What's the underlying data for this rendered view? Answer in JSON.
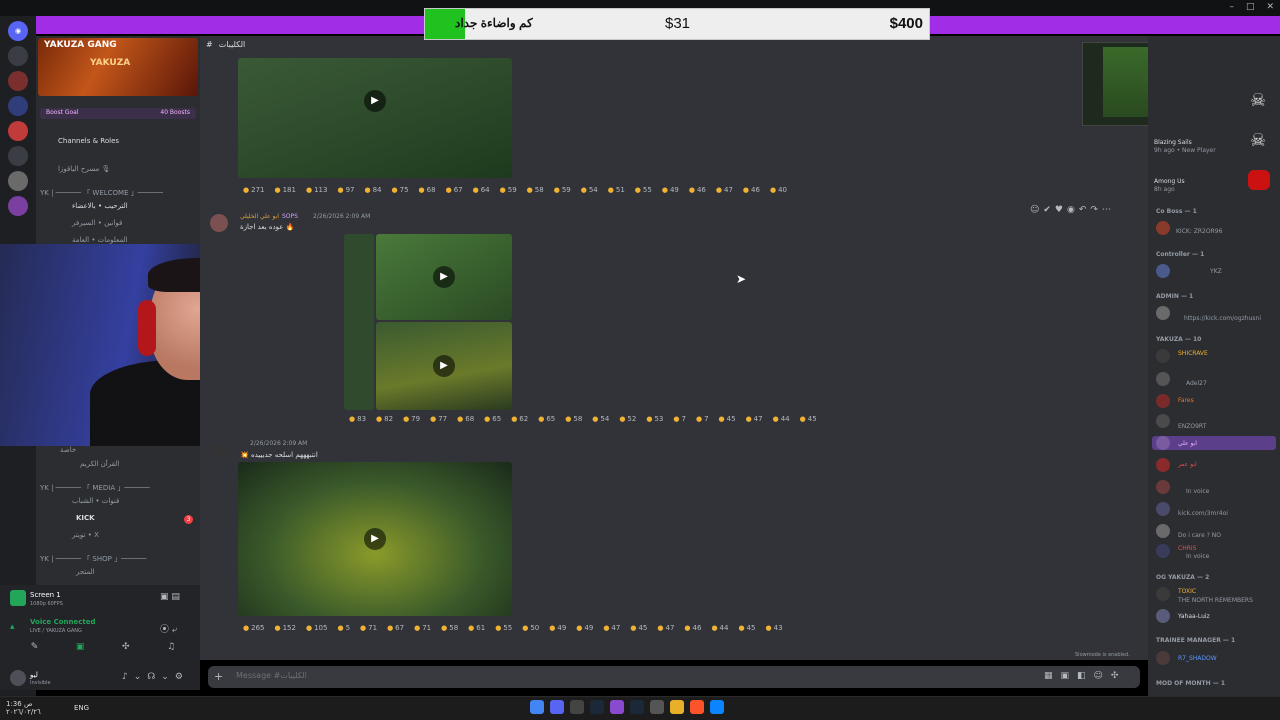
{
  "window": {
    "title": "YAKUZA GANG",
    "controls": [
      "–",
      "□",
      "✕"
    ]
  },
  "donation_goal": {
    "label": "كم واضاءة جداد",
    "current": "$31",
    "target": "$400",
    "progress": 0.0775
  },
  "server": {
    "name": "YAKUZA GANG",
    "banner_text": "YAKUZA",
    "boost_label": "Boost Goal",
    "boost_count": "40 Boosts",
    "channels": [
      {
        "label": "Channels & Roles"
      },
      {
        "label": "مسرح الياقوزا 🎙"
      },
      {
        "label": "YK | ────── 「 WELCOME 」──────"
      },
      {
        "label": "الترحيب • بالاعضاء"
      },
      {
        "label": "قوانين • السيرفر"
      },
      {
        "label": "المعلومات • العامة"
      },
      {
        "label": "خاصة"
      },
      {
        "label": "القرآن الكريم"
      },
      {
        "label": "YK | ────── 「 MEDIA 」──────"
      },
      {
        "label": "قنوات • الشباب"
      },
      {
        "label": "KICK"
      },
      {
        "label": "تويتر • X"
      },
      {
        "label": "YK | ────── 「 SHOP 」──────"
      },
      {
        "label": "المتجر"
      }
    ],
    "kick_badge": "3"
  },
  "voice": {
    "screen_label": "Screen 1",
    "screen_sub": "1080p 60FPS",
    "status": "Voice Connected",
    "channel": "LIVE / YAKUZA GANG",
    "user": "ليو",
    "user_status": "Invisible"
  },
  "chat": {
    "channel": "الكليبات",
    "input_placeholder": "Message #الكليبات",
    "slowmode": "Slowmode is enabled.",
    "messages": [
      {
        "reactions": [
          "271",
          "181",
          "113",
          "97",
          "84",
          "75",
          "68",
          "67",
          "64",
          "59",
          "58",
          "59",
          "54",
          "51",
          "55",
          "49",
          "46",
          "47",
          "46",
          "40"
        ]
      },
      {
        "author": "ابو علي الخليلي",
        "tag": "SOPS",
        "time": "2/26/2026 2:09 AM",
        "text": "عوده بعد اجازة 🔥",
        "reactions": [
          "83",
          "82",
          "79",
          "77",
          "68",
          "65",
          "62",
          "65",
          "58",
          "54",
          "52",
          "53",
          "7",
          "7",
          "45",
          "47",
          "44",
          "45"
        ]
      },
      {
        "author": "",
        "time": "2/26/2026 2:09 AM",
        "text": "💥 انتبهههم اسلحه جديييده",
        "reactions": [
          "265",
          "152",
          "105",
          "5",
          "71",
          "67",
          "71",
          "58",
          "61",
          "55",
          "50",
          "49",
          "49",
          "47",
          "45",
          "47",
          "46",
          "44",
          "45",
          "43"
        ]
      }
    ]
  },
  "members": {
    "activities": [
      {
        "name": "Blazing Sails",
        "sub": "9h ago • New Player"
      },
      {
        "name": "Among Us",
        "sub": "8h ago"
      }
    ],
    "groups": [
      {
        "title": "Co Boss — 1",
        "members": [
          "KICK: ZR2OR96"
        ]
      },
      {
        "title": "Controller — 1",
        "members": [
          "YKZ"
        ]
      },
      {
        "title": "ADMIN — 1",
        "members": [
          "https://kick.com/ogzhusni"
        ]
      },
      {
        "title": "YAKUZA — 10",
        "members": [
          "SHICRAVE",
          "Adel27",
          "Fares",
          "ENZO9RT",
          "ابو علي",
          "ابو عمر",
          "In voice",
          "kick.com/3mr4oi",
          "Do i care ? NO",
          "CHRIS",
          "In voice"
        ]
      },
      {
        "title": "OG YAKUZA — 2",
        "members": [
          "TOXIC",
          "THE NORTH REMEMBERS",
          "Yahaa-Luiz"
        ]
      },
      {
        "title": "TRAINEE MANAGER — 1",
        "members": [
          "R7_SHADOW"
        ]
      },
      {
        "title": "MOD OF MONTH — 1",
        "members": []
      }
    ]
  },
  "taskbar": {
    "time": "1:36 ص",
    "date": "٢٠٢٦/٠٢/٢٦",
    "lang": "ENG",
    "apps": [
      "chrome",
      "discord",
      "obs",
      "steam-icon",
      "app",
      "steam",
      "calc",
      "files",
      "brave",
      "windows"
    ]
  },
  "colors": {
    "accent": "#a12ee6",
    "goal_fill": "#1fc21f",
    "chat_bg": "#313338",
    "sidebar_bg": "#2b2d31"
  }
}
